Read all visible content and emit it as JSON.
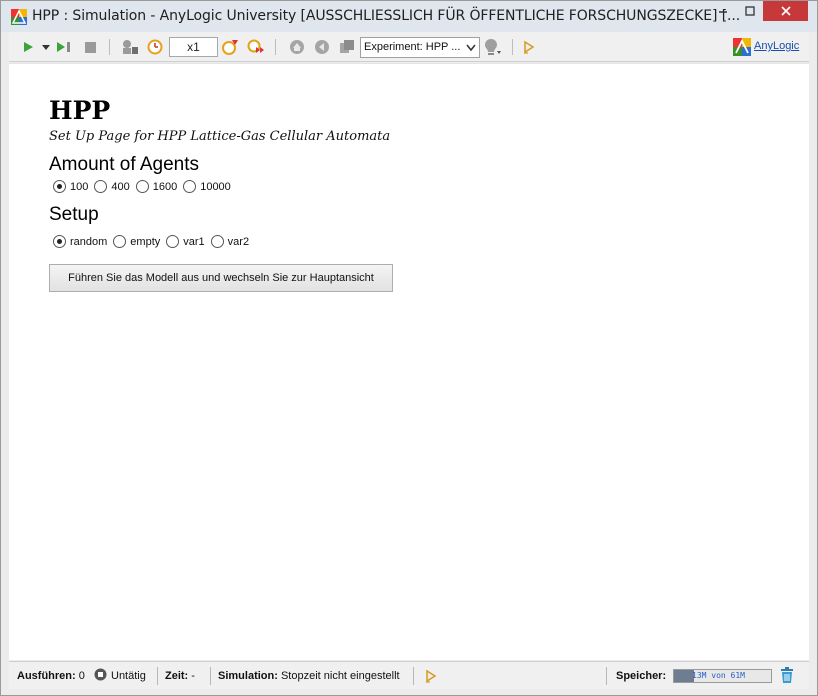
{
  "window": {
    "title": "HPP : Simulation - AnyLogic University  [AUSSCHLIESSLICH FÜR ÖFFENTLICHE FORSCHUNGSZECKE] [...",
    "minimize_icon": "minimize-icon",
    "maximize_icon": "maximize-icon",
    "close_icon": "close-icon"
  },
  "toolbar": {
    "speed": "x1",
    "experiment_select": "Experiment: HPP ...",
    "brand_link": "AnyLogic",
    "icons": [
      "run-icon",
      "dropdown-icon",
      "step-icon",
      "stop-icon",
      "agent-icon",
      "realtime-icon",
      "speed-slower-icon",
      "speed-faster-icon",
      "home-icon",
      "back-icon",
      "navigate-icon",
      "view-icon",
      "trace-icon"
    ]
  },
  "page": {
    "title": "HPP",
    "subtitle": "Set Up Page for HPP Lattice-Gas Cellular Automata",
    "agents_heading": "Amount of Agents",
    "agents_options": [
      "100",
      "400",
      "1600",
      "10000"
    ],
    "agents_selected": "100",
    "setup_heading": "Setup",
    "setup_options": [
      "random",
      "empty",
      "var1",
      "var2"
    ],
    "setup_selected": "random",
    "run_button": "Führen Sie das Modell aus und wechseln Sie zur Hauptansicht"
  },
  "status": {
    "run_label": "Ausführen:",
    "run_count": "0",
    "run_state": "Untätig",
    "time_label": "Zeit:",
    "time_value": "-",
    "sim_label": "Simulation:",
    "sim_value": "Stopzeit nicht eingestellt",
    "memory_label": "Speicher:",
    "memory_text": "13M von 61M",
    "memory_fraction": 0.21
  },
  "colors": {
    "titlebar": "#dfe6ee",
    "close_button": "#c7383a",
    "link": "#1a4fb0",
    "memory_fill": "#6f7d92"
  }
}
